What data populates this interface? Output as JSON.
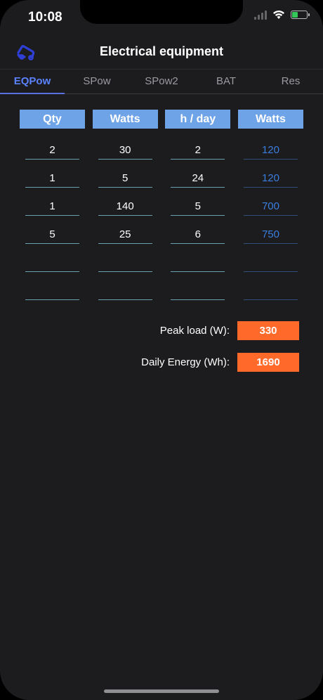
{
  "status": {
    "time": "10:08",
    "battery_color": "#34c759"
  },
  "nav": {
    "title": "Electrical equipment",
    "back_icon": "car-back-icon",
    "accent": "#2f3fd6"
  },
  "tabs": [
    {
      "label": "EQPow",
      "active": true
    },
    {
      "label": "SPow",
      "active": false
    },
    {
      "label": "SPow2",
      "active": false
    },
    {
      "label": "BAT",
      "active": false
    },
    {
      "label": "Res",
      "active": false
    }
  ],
  "table": {
    "headers": [
      "Qty",
      "Watts",
      "h / day",
      "Watts"
    ],
    "rows": [
      [
        "2",
        "30",
        "2",
        "120"
      ],
      [
        "1",
        "5",
        "24",
        "120"
      ],
      [
        "1",
        "140",
        "5",
        "700"
      ],
      [
        "5",
        "25",
        "6",
        "750"
      ],
      [
        "",
        "",
        "",
        ""
      ],
      [
        "",
        "",
        "",
        ""
      ]
    ]
  },
  "summary": {
    "peak_label": "Peak load (W):",
    "peak_value": "330",
    "energy_label": "Daily Energy (Wh):",
    "energy_value": "1690",
    "value_color": "#ff6a2b"
  }
}
